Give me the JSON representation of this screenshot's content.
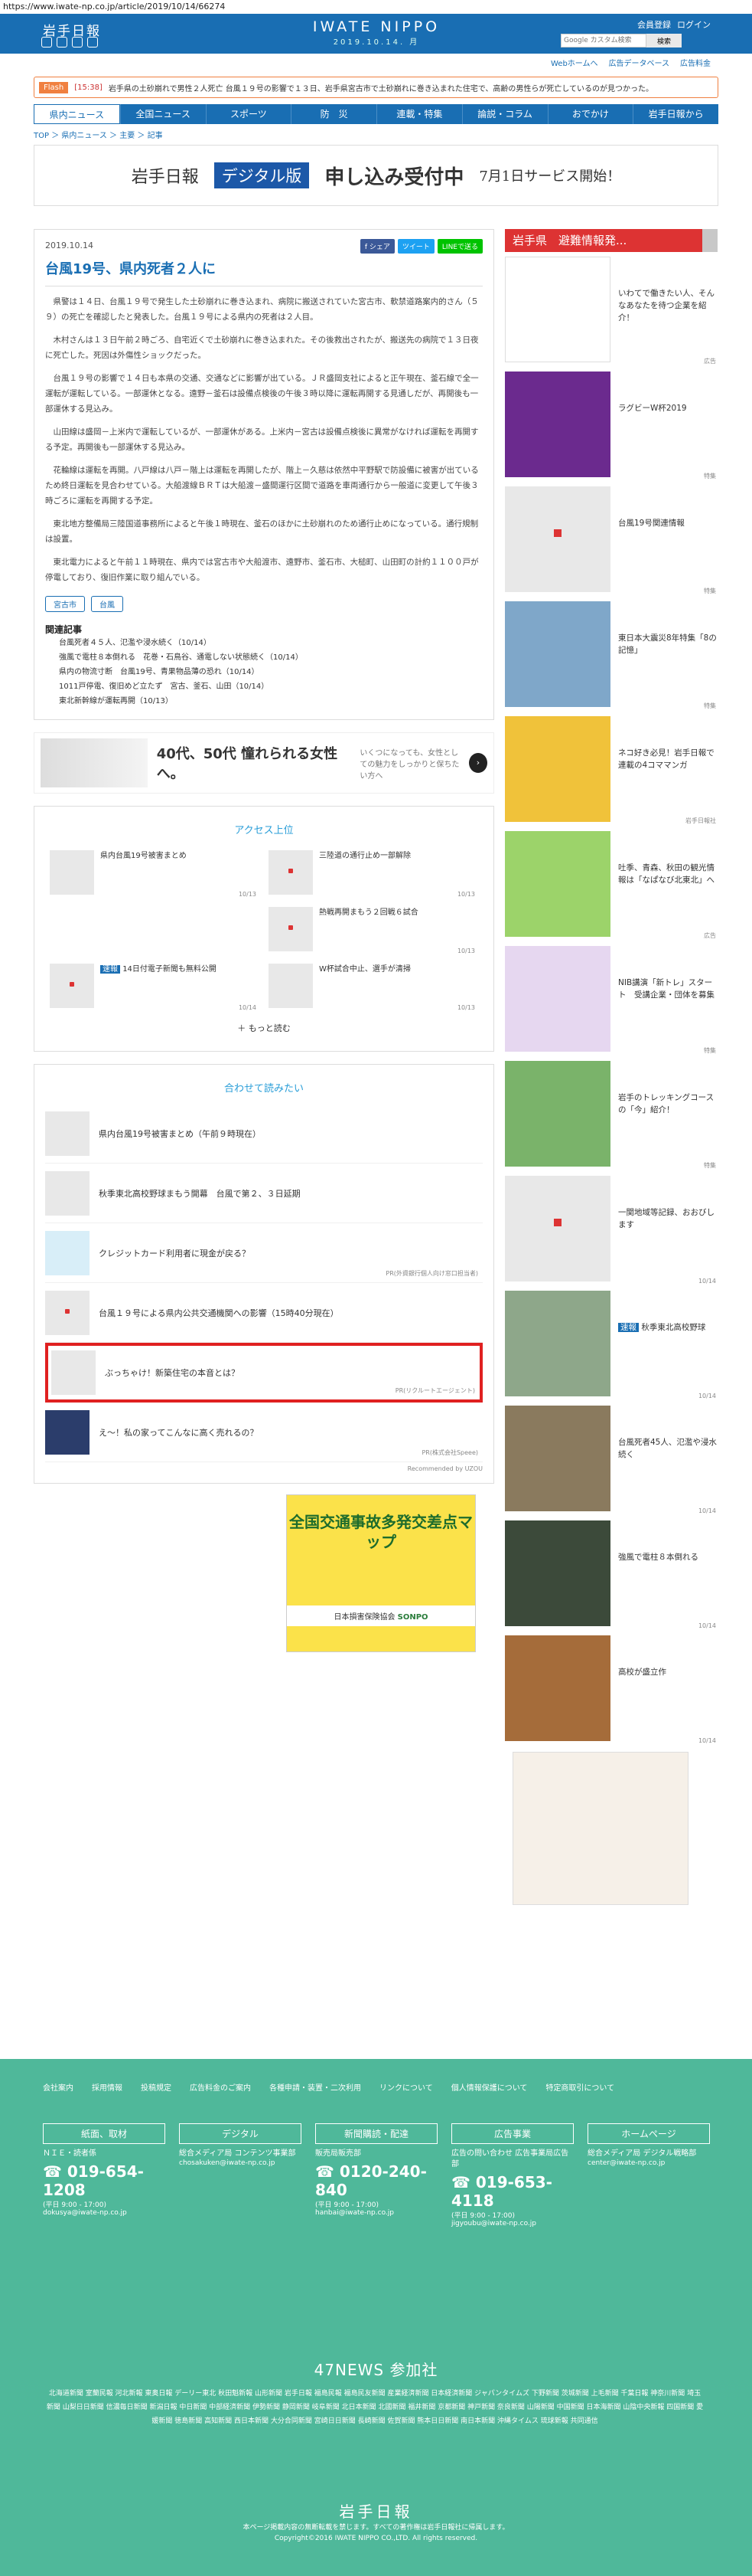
{
  "url": "https://www.iwate-np.co.jp/article/2019/10/14/66274",
  "header": {
    "logo": "岩手日報",
    "brand": "IWATE NIPPO",
    "date": "2019.10.14. 月",
    "links": [
      "会員登録",
      "ログイン"
    ],
    "search_placeholder": "Google カスタム検索",
    "search_button": "検索"
  },
  "subbar": [
    "Webホームへ",
    "広告データベース",
    "広告料金"
  ],
  "flash": {
    "tag": "Flash",
    "time": "[15:38]",
    "text": "岩手県の土砂崩れで男性２人死亡 台風１９号の影響で１３日、岩手県宮古市で土砂崩れに巻き込まれた住宅で、高齢の男性らが死亡しているのが見つかった。"
  },
  "nav": [
    "県内ニュース",
    "全国ニュース",
    "スポーツ",
    "防　災",
    "連載・特集",
    "論説・コラム",
    "おでかけ",
    "岩手日報から"
  ],
  "crumb": "TOP ＞ 県内ニュース ＞ 主要 ＞ 記事",
  "banner": {
    "b1": "岩手日報",
    "b2": "デジタル版",
    "b3": "申し込み受付中",
    "b4": "7月1日サービス開始！"
  },
  "article": {
    "date": "2019.10.14",
    "share": [
      "f シェア",
      "ツイート",
      "LINEで送る"
    ],
    "title": "台風19号、県内死者２人に",
    "body": [
      "県警は１４日、台風１９号で発生した土砂崩れに巻き込まれ、病院に搬送されていた宮古市、軟禁道路案内的さん（５９）の死亡を確認したと発表した。台風１９号による県内の死者は２人目。",
      "木村さんは１３日午前２時ごろ、自宅近くで土砂崩れに巻き込まれた。その後救出されたが、搬送先の病院で１３日夜に死亡した。死因は外傷性ショックだった。",
      "台風１９号の影響で１４日も本県の交通、交通などに影響が出ている。ＪＲ盛岡支社によると正午現在、釜石線で全一運転が運転している。一部運休となる。遠野－釜石は設備点検後の午後３時以降に運転再開する見通しだが、再開後も一部運休する見込み。",
      "山田線は盛岡－上米内で運転しているが、一部運休がある。上米内－宮古は設備点検後に異常がなければ運転を再開する予定。再開後も一部運休する見込み。",
      "花輪線は運転を再開。八戸線は八戸－階上は運転を再開したが、階上－久慈は依然中平野駅で防設備に被害が出ているため終日運転を見合わせている。大船渡線ＢＲＴは大船渡－盛間運行区間で道路を車両通行から一般道に変更して午後３時ごろに運転を再開する予定。",
      "東北地方整備局三陸国道事務所によると午後１時現在、釜石のほかに土砂崩れのため通行止めになっている。通行規制は設置。",
      "東北電力によると午前１１時現在、県内では宮古市や大船渡市、遠野市、釜石市、大槌町、山田町の計約１１００戸が停電しており、復旧作業に取り組んでいる。"
    ],
    "tags": [
      "宮古市",
      "台風"
    ],
    "rel_title": "関連記事",
    "related": [
      "台風死者４５人、氾濫や浸水続く（10/14）",
      "強風で電柱８本倒れる　花巻・石鳥谷、通電しない状態続く（10/14）",
      "県内の物流寸断　台風19号、青果物品薄の恐れ（10/14）",
      "1011戸停電、復旧めど立たず　宮古、釜石、山田（10/14）",
      "東北新幹線が運転再開（10/13）"
    ]
  },
  "ad": {
    "headline": "40代、50代 憧れられる女性へ。",
    "sub": "いくつになっても、女性としての魅力をしっかりと保ちたい方へ"
  },
  "access": {
    "title": "アクセス上位",
    "items": [
      {
        "t": "県内台風19号被害まとめ",
        "d": "10/13"
      },
      {
        "t": "三陸道の通行止め一部解除",
        "d": "10/13"
      },
      {
        "t": "",
        "d": ""
      },
      {
        "t": "熱戦再開まもう２回戦６試合",
        "d": "10/13"
      },
      {
        "t": "14日付電子新聞も無料公開",
        "d": "10/14",
        "badge": "速報"
      },
      {
        "t": "W杯試合中止、選手が清掃",
        "d": "10/13"
      }
    ],
    "more": "＋ もっと読む"
  },
  "rec": {
    "title": "合わせて読みたい",
    "items": [
      {
        "t": "県内台風19号被害まとめ（午前９時現在）",
        "pr": ""
      },
      {
        "t": "秋季東北高校野球まもう開幕　台風で第２、３日延期",
        "pr": ""
      },
      {
        "t": "クレジットカード利用者に現金が戻る？",
        "pr": "PR(外資銀行個人向け窓口担当者)"
      },
      {
        "t": "台風１９号による県内公共交通機関への影響（15時40分現在）",
        "pr": ""
      },
      {
        "t": "ぶっちゃけ！新築住宅の本音とは？",
        "pr": "PR(リクルートエージェント)"
      },
      {
        "t": "え〜！私の家ってこんなに高く売れるの？",
        "pr": "PR(株式会社Speee)"
      }
    ],
    "credit": "Recommended by UZOU"
  },
  "side": {
    "title": "岩手県　避難情報発...",
    "items": [
      {
        "t": "いわてで働きたい人、そんなあなたを待つ企業を紹介！",
        "s": "広告"
      },
      {
        "t": "ラグビーW杯2019",
        "s": "特集"
      },
      {
        "t": "台風19号関連情報",
        "s": "特集"
      },
      {
        "t": "東日本大震災8年特集「8の記憶」",
        "s": "特集"
      },
      {
        "t": "ネコ好き必見！岩手日報で連載の4コママンガ",
        "s": "岩手日報社"
      },
      {
        "t": "吐季、青森、秋田の観光情報は「なぱなび北東北」へ",
        "s": "広告"
      },
      {
        "t": "NIB講演「新トレ」スタート　受講企業・団体を募集",
        "s": "特集"
      },
      {
        "t": "岩手のトレッキングコースの「今」紹介！",
        "s": "特集"
      },
      {
        "t": "一関地域等記録、おおびします",
        "d": "10/14"
      },
      {
        "t": "秋季東北高校野球",
        "d": "10/14",
        "badge": "速報"
      },
      {
        "t": "台風死者45人、氾濫や浸水続く",
        "d": "10/14"
      },
      {
        "t": "強風で電柱８本倒れる",
        "d": "10/14"
      },
      {
        "t": "高校が盛立作",
        "d": "10/14"
      }
    ],
    "ad_title": "全国交通事故多発交差点マップ",
    "ad_org": "日本損害保険協会",
    "ad_brand": "SONPO"
  },
  "footer": {
    "links": [
      "会社案内",
      "採用情報",
      "投稿規定",
      "広告料金のご案内",
      "各種申請・装置・二次利用",
      "リンクについて",
      "個人情報保護について",
      "特定商取引について"
    ],
    "cols": [
      {
        "h": "紙面、取材",
        "t": "ＮＩＥ・読者係",
        "ph": "019-654-1208",
        "sm": "(平日 9:00 - 17:00)",
        "mail": "dokusya@iwate-np.co.jp"
      },
      {
        "h": "デジタル",
        "t": "総合メディア局 コンテンツ事業部",
        "ph": "",
        "sm": "",
        "mail": "chosakuken@iwate-np.co.jp"
      },
      {
        "h": "新聞購読・配達",
        "t": "販売局販売部",
        "ph": "0120-240-840",
        "sm": "(平日 9:00 - 17:00)",
        "mail": "hanbai@iwate-np.co.jp"
      },
      {
        "h": "広告事業",
        "t": "広告の問い合わせ 広告事業局広告部",
        "ph": "019-653-4118",
        "sm": "(平日 9:00 - 17:00)",
        "mail": "jigyoubu@iwate-np.co.jp"
      },
      {
        "h": "ホームページ",
        "t": "総合メディア局 デジタル戦略部",
        "ph": "",
        "sm": "",
        "mail": "center@iwate-np.co.jp"
      }
    ],
    "n47": "47NEWS 参加社",
    "n47list": "北海道新聞 室蘭民報 河北新報 東奥日報 デーリー東北 秋田魁新報 山形新聞 岩手日報 福島民報 福島民友新聞 産業経済新聞 日本経済新聞 ジャパンタイムズ 下野新聞 茨城新聞 上毛新聞 千葉日報 神奈川新聞 埼玉新聞 山梨日日新聞 信濃毎日新聞 新潟日報 中日新聞 中部経済新聞 伊勢新聞 静岡新聞 岐阜新聞 北日本新聞 北國新聞 福井新聞 京都新聞 神戸新聞 奈良新聞 山陽新聞 中国新聞 日本海新聞 山陰中央新報 四国新聞 愛媛新聞 徳島新聞 高知新聞 西日本新聞 大分合同新聞 宮崎日日新聞 長崎新聞 佐賀新聞 熊本日日新聞 南日本新聞 沖縄タイムス 琉球新報 共同通信",
    "logo": "岩手日報",
    "copy1": "本ページ掲載内容の無断転載を禁じます。すべての著作権は岩手日報社に帰属します。",
    "copy2": "Copyright©2016 IWATE NIPPO CO.,LTD. All rights reserved."
  }
}
